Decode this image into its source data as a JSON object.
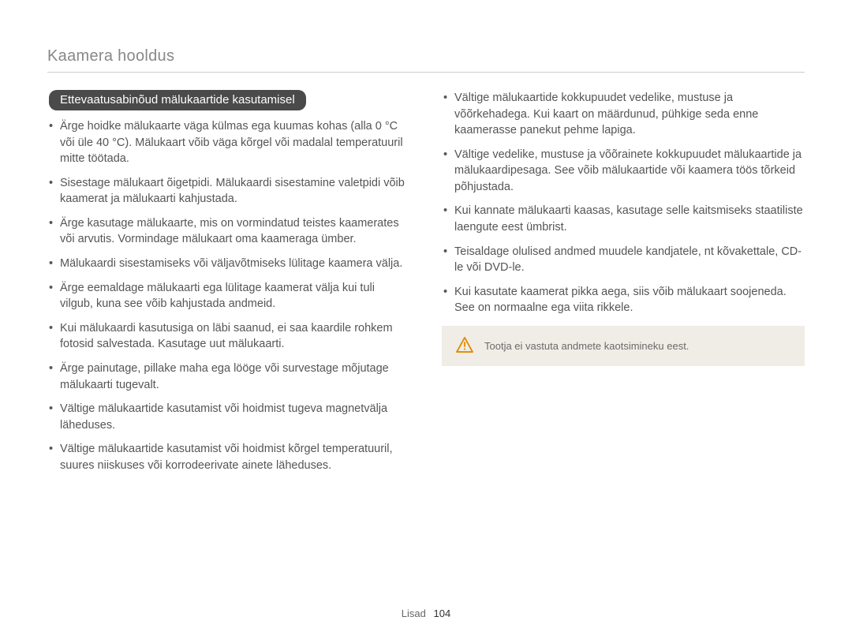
{
  "header": {
    "title": "Kaamera hooldus"
  },
  "section": {
    "heading": "Ettevaatusabinõud mälukaartide kasutamisel"
  },
  "left_items": [
    "Ärge hoidke mälukaarte väga külmas ega kuumas kohas (alla 0 °C või üle 40 °C). Mälukaart võib väga kõrgel või madalal temperatuuril mitte töötada.",
    "Sisestage mälukaart õigetpidi. Mälukaardi sisestamine valetpidi võib kaamerat ja mälukaarti kahjustada.",
    "Ärge kasutage mälukaarte, mis on vormindatud teistes kaamerates või arvutis. Vormindage mälukaart oma kaameraga ümber.",
    "Mälukaardi sisestamiseks või väljavõtmiseks lülitage kaamera välja.",
    "Ärge eemaldage mälukaarti ega lülitage kaamerat välja kui tuli vilgub, kuna see võib kahjustada andmeid.",
    "Kui mälukaardi kasutusiga on läbi saanud, ei saa kaardile rohkem fotosid salvestada. Kasutage uut mälukaarti.",
    "Ärge painutage, pillake maha ega lööge või survestage mõjutage mälukaarti tugevalt.",
    "Vältige mälukaartide kasutamist või hoidmist tugeva magnetvälja läheduses.",
    "Vältige mälukaartide kasutamist või hoidmist kõrgel temperatuuril, suures niiskuses või korrodeerivate ainete läheduses."
  ],
  "right_items": [
    "Vältige mälukaartide kokkupuudet vedelike, mustuse ja võõrkehadega. Kui kaart on määrdunud, pühkige seda enne kaamerasse panekut pehme lapiga.",
    "Vältige vedelike, mustuse ja võõrainete kokkupuudet mälukaartide ja mälukaardipesaga. See võib mälukaartide või kaamera töös tõrkeid põhjustada.",
    "Kui kannate mälukaarti kaasas, kasutage selle kaitsmiseks staatiliste laengute eest ümbrist.",
    "Teisaldage olulised andmed muudele kandjatele, nt kõvakettale, CD-le või DVD-le.",
    "Kui kasutate kaamerat pikka aega, siis võib mälukaart soojeneda. See on normaalne ega viita rikkele."
  ],
  "note": {
    "text": "Tootja ei vastuta andmete kaotsimineku eest."
  },
  "footer": {
    "section": "Lisad",
    "page_number": "104"
  }
}
